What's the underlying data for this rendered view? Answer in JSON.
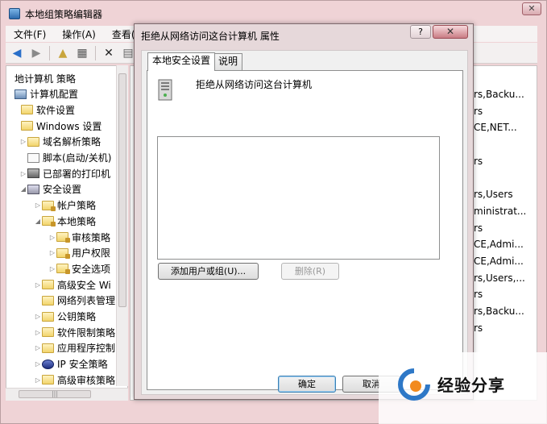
{
  "main_window": {
    "title": "本地组策略编辑器",
    "close_label": "✕",
    "menu": [
      "文件(F)",
      "操作(A)",
      "查看(V)"
    ]
  },
  "toolbar": {
    "icons": [
      "back-icon",
      "forward-icon",
      "up-folder-icon",
      "show-hide-tree-icon",
      "delete-icon",
      "properties-icon"
    ]
  },
  "tree": {
    "items": [
      {
        "label": "地计算机 策略",
        "icon": "policy",
        "indent": 0,
        "arrow": ""
      },
      {
        "label": "计算机配置",
        "icon": "computer",
        "indent": 0,
        "arrow": ""
      },
      {
        "label": "软件设置",
        "icon": "folder",
        "indent": 1,
        "arrow": ""
      },
      {
        "label": "Windows 设置",
        "icon": "folder",
        "indent": 1,
        "arrow": ""
      },
      {
        "label": "域名解析策略",
        "icon": "folder",
        "indent": 2,
        "arrow": "▷"
      },
      {
        "label": "脚本(启动/关机)",
        "icon": "script",
        "indent": 2,
        "arrow": ""
      },
      {
        "label": "已部署的打印机",
        "icon": "printer",
        "indent": 2,
        "arrow": "▷"
      },
      {
        "label": "安全设置",
        "icon": "security",
        "indent": 2,
        "arrow": "◢"
      },
      {
        "label": "帐户策略",
        "icon": "lockfolder",
        "indent": 3,
        "arrow": "▷"
      },
      {
        "label": "本地策略",
        "icon": "lockfolder",
        "indent": 3,
        "arrow": "◢"
      },
      {
        "label": "审核策略",
        "icon": "lockfolder",
        "indent": 4,
        "arrow": "▷"
      },
      {
        "label": "用户权限",
        "icon": "lockfolder",
        "indent": 4,
        "arrow": "▷"
      },
      {
        "label": "安全选项",
        "icon": "lockfolder",
        "indent": 4,
        "arrow": "▷"
      },
      {
        "label": "高级安全 Wi",
        "icon": "folder",
        "indent": 3,
        "arrow": "▷"
      },
      {
        "label": "网络列表管理",
        "icon": "folder",
        "indent": 3,
        "arrow": ""
      },
      {
        "label": "公钥策略",
        "icon": "folder",
        "indent": 3,
        "arrow": "▷"
      },
      {
        "label": "软件限制策略",
        "icon": "folder",
        "indent": 3,
        "arrow": "▷"
      },
      {
        "label": "应用程序控制",
        "icon": "folder",
        "indent": 3,
        "arrow": "▷"
      },
      {
        "label": "IP 安全策略",
        "icon": "ipsec",
        "indent": 3,
        "arrow": "▷"
      },
      {
        "label": "高级审核策略",
        "icon": "folder",
        "indent": 3,
        "arrow": "▷"
      }
    ],
    "hscroll_grip": "|||"
  },
  "list": {
    "rows": [
      "rs,Backu...",
      "rs",
      "CE,NET...",
      "",
      "rs",
      "",
      "rs,Users",
      "ministrat...",
      "rs",
      "CE,Admi...",
      "CE,Admi...",
      "rs,Users,...",
      "rs",
      "rs,Backu...",
      "rs"
    ]
  },
  "dialog": {
    "title": "拒绝从网络访问这台计算机 属性",
    "help_label": "?",
    "close_label": "✕",
    "tabs": [
      "本地安全设置",
      "说明"
    ],
    "policy_name": "拒绝从网络访问这台计算机",
    "add_button": "添加用户或组(U)...",
    "remove_button": "删除(R)",
    "ok_button": "确定",
    "cancel_button": "取消"
  },
  "watermark": {
    "text": "经验分享",
    "logo": "Baidu jingyan logo"
  }
}
